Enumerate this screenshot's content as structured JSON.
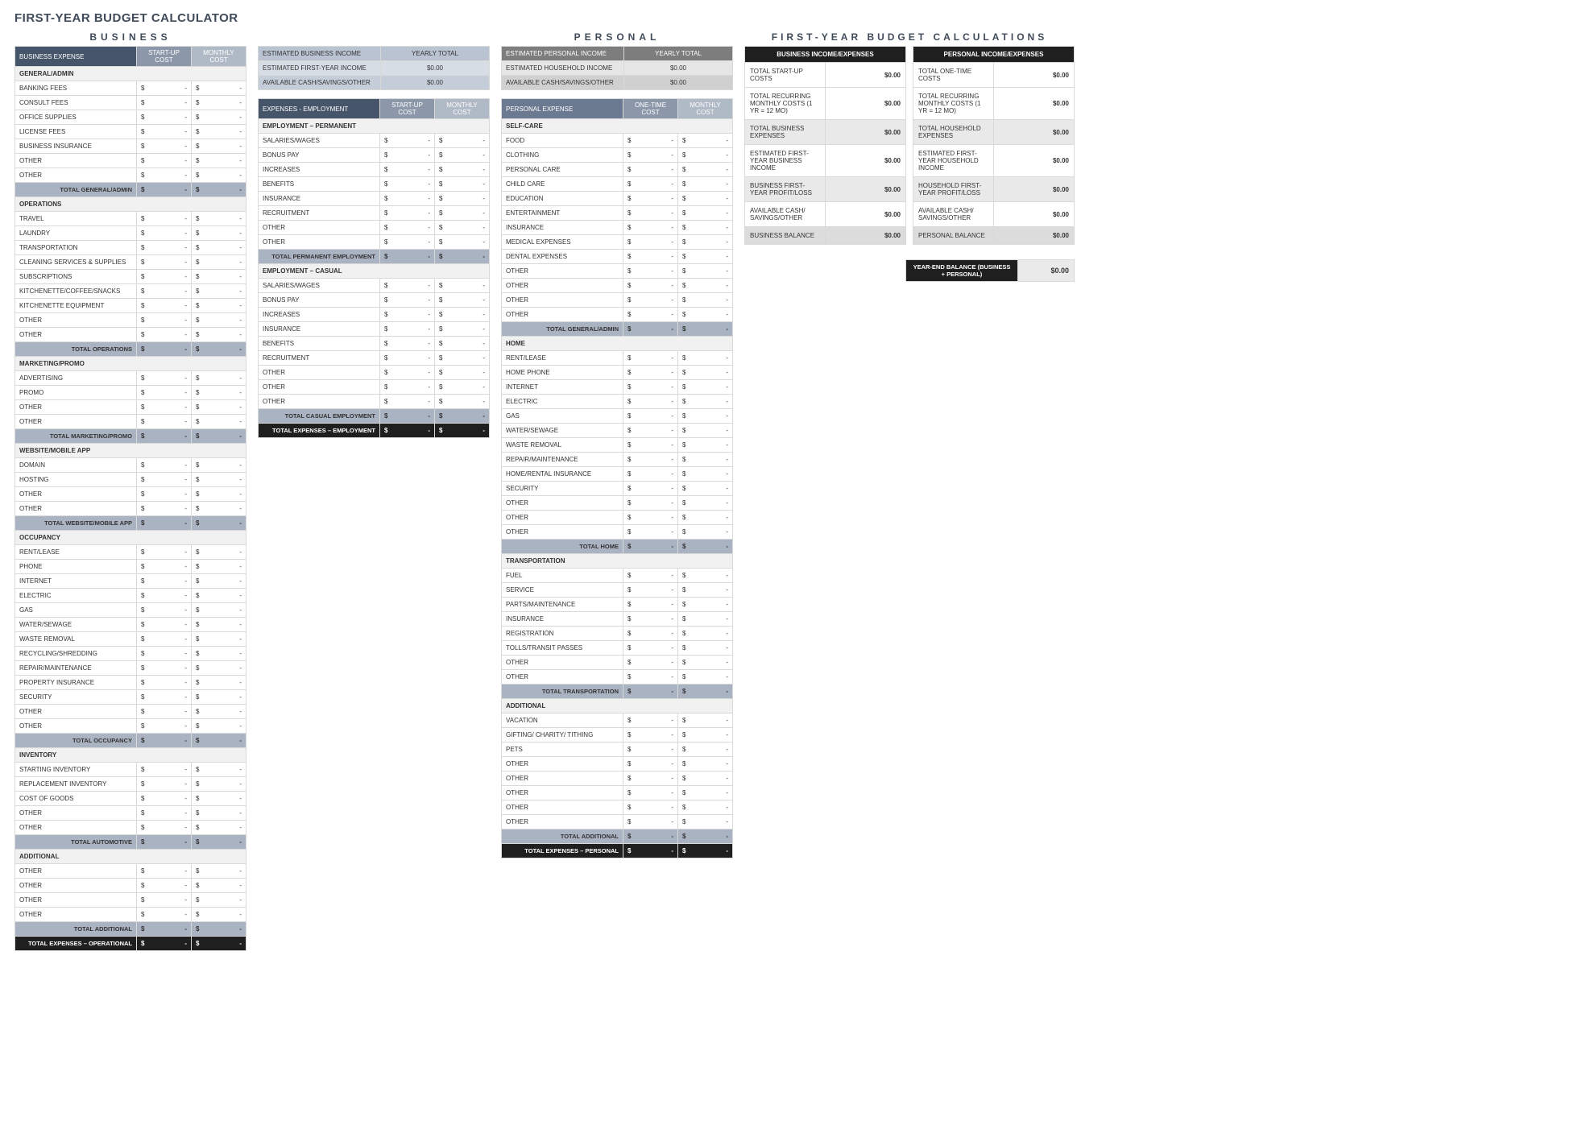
{
  "title": "FIRST-YEAR BUDGET CALCULATOR",
  "section_titles": {
    "business": "BUSINESS",
    "personal": "PERSONAL",
    "calc": "FIRST-YEAR BUDGET CALCULATIONS"
  },
  "headers": {
    "biz_expense": "BUSINESS EXPENSE",
    "startup": "START-UP COST",
    "monthly": "MONTHLY COST",
    "exp_emp": "EXPENSES - EMPLOYMENT",
    "pers_expense": "PERSONAL EXPENSE",
    "onetime": "ONE-TIME COST"
  },
  "biz_income": {
    "rows": [
      "ESTIMATED BUSINESS INCOME",
      "ESTIMATED FIRST-YEAR INCOME",
      "AVAILABLE CASH/SAVINGS/OTHER"
    ],
    "yearly": "YEARLY TOTAL",
    "vals": [
      "",
      "$0.00",
      "$0.00"
    ]
  },
  "pers_income": {
    "rows": [
      "ESTIMATED PERSONAL INCOME",
      "ESTIMATED HOUSEHOLD INCOME",
      "AVAILABLE CASH/SAVINGS/OTHER"
    ],
    "yearly": "YEARLY TOTAL",
    "vals": [
      "",
      "$0.00",
      "$0.00"
    ]
  },
  "biz": [
    {
      "cat": "GENERAL/ADMIN",
      "rows": [
        "BANKING FEES",
        "CONSULT FEES",
        "OFFICE SUPPLIES",
        "LICENSE FEES",
        "BUSINESS INSURANCE",
        "OTHER",
        "OTHER"
      ],
      "total": "TOTAL GENERAL/ADMIN"
    },
    {
      "cat": "OPERATIONS",
      "rows": [
        "TRAVEL",
        "LAUNDRY",
        "TRANSPORTATION",
        "CLEANING SERVICES & SUPPLIES",
        "SUBSCRIPTIONS",
        "KITCHENETTE/COFFEE/SNACKS",
        "KITCHENETTE EQUIPMENT",
        "OTHER",
        "OTHER"
      ],
      "total": "TOTAL OPERATIONS"
    },
    {
      "cat": "MARKETING/PROMO",
      "rows": [
        "ADVERTISING",
        "PROMO",
        "OTHER",
        "OTHER"
      ],
      "total": "TOTAL MARKETING/PROMO"
    },
    {
      "cat": "WEBSITE/MOBILE APP",
      "rows": [
        "DOMAIN",
        "HOSTING",
        "OTHER",
        "OTHER"
      ],
      "total": "TOTAL WEBSITE/MOBILE APP"
    },
    {
      "cat": "OCCUPANCY",
      "rows": [
        "RENT/LEASE",
        "PHONE",
        "INTERNET",
        "ELECTRIC",
        "GAS",
        "WATER/SEWAGE",
        "WASTE REMOVAL",
        "RECYCLING/SHREDDING",
        "REPAIR/MAINTENANCE",
        "PROPERTY INSURANCE",
        "SECURITY",
        "OTHER",
        "OTHER"
      ],
      "total": "TOTAL OCCUPANCY"
    },
    {
      "cat": "INVENTORY",
      "rows": [
        "STARTING INVENTORY",
        "REPLACEMENT INVENTORY",
        "COST OF GOODS",
        "OTHER",
        "OTHER"
      ],
      "total": "TOTAL AUTOMOTIVE"
    },
    {
      "cat": "ADDITIONAL",
      "rows": [
        "OTHER",
        "OTHER",
        "OTHER",
        "OTHER"
      ],
      "total": "TOTAL ADDITIONAL"
    }
  ],
  "biz_grand": "TOTAL EXPENSES – OPERATIONAL",
  "emp": [
    {
      "cat": "EMPLOYMENT – PERMANENT",
      "rows": [
        "SALARIES/WAGES",
        "BONUS PAY",
        "INCREASES",
        "BENEFITS",
        "INSURANCE",
        "RECRUITMENT",
        "OTHER",
        "OTHER"
      ],
      "total": "TOTAL PERMANENT EMPLOYMENT"
    },
    {
      "cat": "EMPLOYMENT – CASUAL",
      "rows": [
        "SALARIES/WAGES",
        "BONUS PAY",
        "INCREASES",
        "INSURANCE",
        "BENEFITS",
        "RECRUITMENT",
        "OTHER",
        "OTHER",
        "OTHER"
      ],
      "total": "TOTAL CASUAL EMPLOYMENT"
    }
  ],
  "emp_grand": "TOTAL EXPENSES – EMPLOYMENT",
  "pers": [
    {
      "cat": "SELF-CARE",
      "rows": [
        "FOOD",
        "CLOTHING",
        "PERSONAL CARE",
        "CHILD CARE",
        "EDUCATION",
        "ENTERTAINMENT",
        "INSURANCE",
        "MEDICAL EXPENSES",
        "DENTAL EXPENSES",
        "OTHER",
        "OTHER",
        "OTHER",
        "OTHER"
      ],
      "total": "TOTAL GENERAL/ADMIN"
    },
    {
      "cat": "HOME",
      "rows": [
        "RENT/LEASE",
        "HOME PHONE",
        "INTERNET",
        "ELECTRIC",
        "GAS",
        "WATER/SEWAGE",
        "WASTE REMOVAL",
        "REPAIR/MAINTENANCE",
        "HOME/RENTAL INSURANCE",
        "SECURITY",
        "OTHER",
        "OTHER",
        "OTHER"
      ],
      "total": "TOTAL HOME"
    },
    {
      "cat": "TRANSPORTATION",
      "rows": [
        "FUEL",
        "SERVICE",
        "PARTS/MAINTENANCE",
        "INSURANCE",
        "REGISTRATION",
        "TOLLS/TRANSIT PASSES",
        "OTHER",
        "OTHER"
      ],
      "total": "TOTAL TRANSPORTATION"
    },
    {
      "cat": "ADDITIONAL",
      "rows": [
        "VACATION",
        "GIFTING/ CHARITY/ TITHING",
        "PETS",
        "OTHER",
        "OTHER",
        "OTHER",
        "OTHER",
        "OTHER"
      ],
      "total": "TOTAL ADDITIONAL"
    }
  ],
  "pers_grand": "TOTAL EXPENSES – PERSONAL",
  "calc": {
    "biz_h": "BUSINESS INCOME/EXPENSES",
    "pers_h": "PERSONAL INCOME/EXPENSES",
    "biz_rows": [
      {
        "l": "TOTAL START-UP COSTS",
        "v": "$0.00"
      },
      {
        "l": "TOTAL RECURRING MONTHLY COSTS (1 YR = 12 MO)",
        "v": "$0.00"
      },
      {
        "l": "TOTAL BUSINESS EXPENSES",
        "v": "$0.00",
        "alt": true
      },
      {
        "l": "ESTIMATED FIRST-YEAR BUSINESS INCOME",
        "v": "$0.00"
      },
      {
        "l": "BUSINESS FIRST-YEAR PROFIT/LOSS",
        "v": "$0.00",
        "alt": true
      },
      {
        "l": "AVAILABLE CASH/ SAVINGS/OTHER",
        "v": "$0.00"
      },
      {
        "l": "BUSINESS BALANCE",
        "v": "$0.00",
        "altd": true
      }
    ],
    "pers_rows": [
      {
        "l": "TOTAL ONE-TIME COSTS",
        "v": "$0.00"
      },
      {
        "l": "TOTAL RECURRING MONTHLY COSTS (1 YR = 12 MO)",
        "v": "$0.00"
      },
      {
        "l": "TOTAL HOUSEHOLD EXPENSES",
        "v": "$0.00",
        "alt": true
      },
      {
        "l": "ESTIMATED FIRST-YEAR HOUSEHOLD INCOME",
        "v": "$0.00"
      },
      {
        "l": "HOUSEHOLD FIRST-YEAR PROFIT/LOSS",
        "v": "$0.00",
        "alt": true
      },
      {
        "l": "AVAILABLE CASH/ SAVINGS/OTHER",
        "v": "$0.00"
      },
      {
        "l": "PERSONAL BALANCE",
        "v": "$0.00",
        "altd": true
      }
    ],
    "year_end_l": "YEAR-END BALANCE (BUSINESS + PERSONAL)",
    "year_end_v": "$0.00"
  }
}
